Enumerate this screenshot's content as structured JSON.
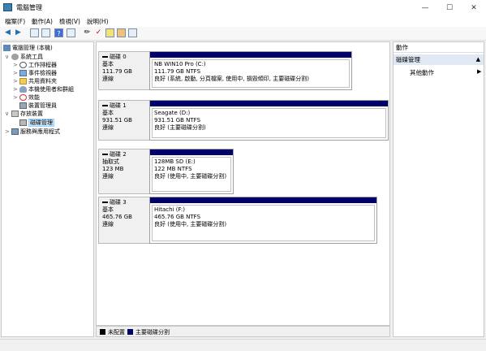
{
  "window": {
    "title": "電腦管理"
  },
  "menu": [
    "檔案(F)",
    "動作(A)",
    "檢視(V)",
    "說明(H)"
  ],
  "tree": [
    {
      "label": "電腦管理 (本機)",
      "indent": 0,
      "twisty": "",
      "icon": "computer-icon"
    },
    {
      "label": "系統工具",
      "indent": 1,
      "twisty": "∨",
      "icon": "tools-icon"
    },
    {
      "label": "工作排程器",
      "indent": 2,
      "twisty": ">",
      "icon": "clock-icon"
    },
    {
      "label": "事件檢視器",
      "indent": 2,
      "twisty": ">",
      "icon": "event-viewer-icon"
    },
    {
      "label": "共用資料夾",
      "indent": 2,
      "twisty": ">",
      "icon": "shared-folder-icon"
    },
    {
      "label": "本機使用者和群組",
      "indent": 2,
      "twisty": ">",
      "icon": "users-icon"
    },
    {
      "label": "效能",
      "indent": 2,
      "twisty": ">",
      "icon": "performance-icon"
    },
    {
      "label": "裝置管理員",
      "indent": 2,
      "twisty": "",
      "icon": "device-manager-icon"
    },
    {
      "label": "存放裝置",
      "indent": 1,
      "twisty": "∨",
      "icon": "storage-icon"
    },
    {
      "label": "磁碟管理",
      "indent": 2,
      "twisty": "",
      "icon": "disk-management-icon",
      "selected": true
    },
    {
      "label": "服務與應用程式",
      "indent": 1,
      "twisty": ">",
      "icon": "services-icon"
    }
  ],
  "disks": [
    {
      "name": "磁碟 0",
      "type": "基本",
      "size": "111.79 GB",
      "status": "連線",
      "partition": {
        "label": "NB WIN10 Pro  (C:)",
        "fs": "111.79 GB NTFS",
        "health": "良好 (系統, 啟動, 分頁檔案, 使用中, 損毀傾印, 主要磁碟分割)"
      }
    },
    {
      "name": "磁碟 1",
      "type": "基本",
      "size": "931.51 GB",
      "status": "連線",
      "partition": {
        "label": "Seagate  (D:)",
        "fs": "931.51 GB NTFS",
        "health": "良好 (主要磁碟分割)"
      }
    },
    {
      "name": "磁碟 2",
      "type": "抽取式",
      "size": "123 MB",
      "status": "連線",
      "partition": {
        "label": "128MB SD  (E:)",
        "fs": "122 MB NTFS",
        "health": "良好 (使用中, 主要磁碟分割)"
      }
    },
    {
      "name": "磁碟 3",
      "type": "基本",
      "size": "465.76 GB",
      "status": "連線",
      "partition": {
        "label": "Hitachi  (F:)",
        "fs": "465.76 GB NTFS",
        "health": "良好 (使用中, 主要磁碟分割)"
      }
    }
  ],
  "legend": [
    {
      "label": "未配置",
      "color": "#000000"
    },
    {
      "label": "主要磁碟分割",
      "color": "#00006b"
    }
  ],
  "actions": {
    "header": "動作",
    "section": "磁碟管理",
    "more": "其他動作"
  }
}
